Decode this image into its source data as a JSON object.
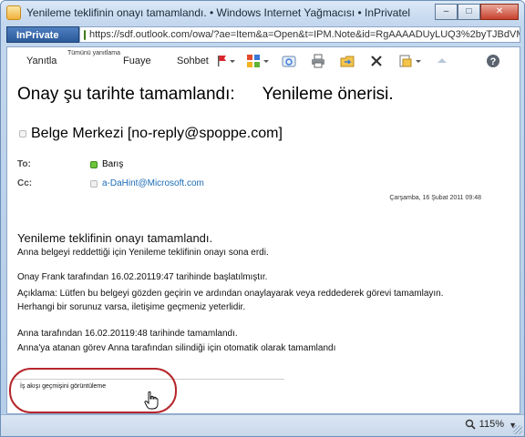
{
  "window": {
    "title": "Yenileme teklifinin onayı tamamlandı. • Windows Internet Yağmacısı • InPrivatel",
    "min_glyph": "–",
    "max_glyph": "□",
    "close_glyph": "✕"
  },
  "address": {
    "inprivate_label": "InPrivate",
    "url": "https://sdf.outlook.com/owa/?ae=Item&a=Open&t=IPM.Note&id=RgAAAADUyLUQ3%2byTJBdVM"
  },
  "toolbar": {
    "reply": "Yanıtla",
    "reply_all": "Tümünü yanıtlama",
    "forward": "Fuaye",
    "chat": "Sohbet"
  },
  "message": {
    "subject_part1": "Onay şu tarihte tamamlandı:",
    "subject_part2": "Yenileme önerisi.",
    "sender": "Belge Merkezi [no-reply@spoppe.com]",
    "to_label": "To:",
    "to_value": "Barış",
    "cc_label": "Cc:",
    "cc_value": "a-DaHint@Microsoft.com",
    "date": "Çarşamba, 16 Şubat 2011 09:48"
  },
  "body": {
    "heading": "Yenileme teklifinin onayı tamamlandı.",
    "line1": "Anna belgeyi reddettiği için Yenileme teklifinin onayı sona erdi.",
    "line2": "Onay Frank tarafından 16.02.20119:47 tarihinde başlatılmıştır.",
    "line3": "Açıklama: Lütfen bu belgeyi gözden geçirin ve ardından onaylayarak veya reddederek görevi tamamlayın.",
    "line4": " Herhangi bir sorunuz varsa, iletişime geçmeniz yeterlidir.",
    "line5": "Anna tarafından 16.02.20119:48 tarihinde tamamlandı.",
    "line6": "Anna'ya atanan görev Anna tarafından silindiği için otomatik olarak tamamlandı",
    "workflow_link": "İş akışı geçmişini görüntüleme"
  },
  "status": {
    "zoom": "115%"
  },
  "colors": {
    "link": "#1c6bb6",
    "highlight": "#b5262c",
    "presence_online": "#6cc43a"
  }
}
